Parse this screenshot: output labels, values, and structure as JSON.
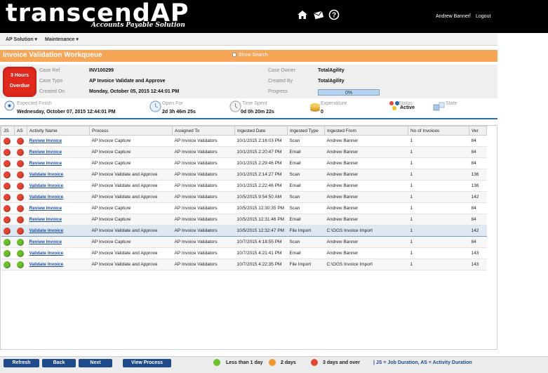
{
  "brand": {
    "name": "transcendAP",
    "tagline": "Accounts Payable Solution"
  },
  "header": {
    "icons": [
      "home-icon",
      "envelope-icon",
      "help-icon"
    ],
    "user": "Andrew Banner",
    "separator": "|",
    "logout": "Logout"
  },
  "menu": {
    "ap_solution": "AP Solution ▾",
    "maintenance": "Maintenance ▾"
  },
  "page": {
    "title": "Invoice Validation Workqueue",
    "show_search": "Show Search"
  },
  "case": {
    "badge_line1": "3 Hours",
    "badge_line2": "Overdue",
    "case_ref_label": "Case Ref",
    "case_ref": "INV100299",
    "case_type_label": "Case Type",
    "case_type": "AP Invoice Validate and Approve",
    "created_on_label": "Created On",
    "created_on": "Monday, October 05, 2015 12:44:01 PM",
    "case_owner_label": "Case Owner",
    "case_owner": "TotalAgility",
    "created_by_label": "Created By",
    "created_by": "TotalAgility",
    "progress_label": "Progress",
    "progress": "0%"
  },
  "stats": {
    "expected_finish_label": "Expected Finish",
    "expected_finish": "Wednesday, October 07, 2015 12:44:01 PM",
    "open_for_label": "Open For",
    "open_for": "2d 3h 46m 25s",
    "time_spent_label": "Time Spent",
    "time_spent": "0d 0h 20m 22s",
    "expenditure_label": "Expenditure",
    "expenditure": "0",
    "status_label": "Status",
    "status": "Active",
    "state_label": "State"
  },
  "table": {
    "columns": [
      "JS",
      "AS",
      "Activity Name",
      "Process",
      "Assigned To",
      "Ingested Date",
      "Ingested Type",
      "Ingested From",
      "No of Invoices",
      "Ver"
    ],
    "rows": [
      {
        "js": "red",
        "as": "red",
        "activity": "Review Invoice",
        "process": "AP Invoice Capture",
        "assigned": "AP Invoice Validators",
        "date": "10/1/2015 2:16:03 PM",
        "type": "Scan",
        "from": "Andrew Banner",
        "count": "1",
        "ver": "84"
      },
      {
        "js": "red",
        "as": "red",
        "activity": "Review Invoice",
        "process": "AP Invoice Capture",
        "assigned": "AP Invoice Validators",
        "date": "10/1/2015 2:20:47 PM",
        "type": "Email",
        "from": "Andrew Banner",
        "count": "1",
        "ver": "84"
      },
      {
        "js": "red",
        "as": "red",
        "activity": "Review Invoice",
        "process": "AP Invoice Capture",
        "assigned": "AP Invoice Validators",
        "date": "10/1/2015 2:29:46 PM",
        "type": "Email",
        "from": "Andrew Banner",
        "count": "1",
        "ver": "84"
      },
      {
        "js": "red",
        "as": "red",
        "activity": "Validate Invoice",
        "process": "AP Invoice Validate and Approve",
        "assigned": "AP Invoice Validators",
        "date": "10/1/2015 2:14:27 PM",
        "type": "Scan",
        "from": "Andrew Banner",
        "count": "1",
        "ver": "136"
      },
      {
        "js": "red",
        "as": "red",
        "activity": "Validate Invoice",
        "process": "AP Invoice Validate and Approve",
        "assigned": "AP Invoice Validators",
        "date": "10/1/2015 2:22:46 PM",
        "type": "Email",
        "from": "Andrew Banner",
        "count": "1",
        "ver": "136"
      },
      {
        "js": "red",
        "as": "red",
        "activity": "Validate Invoice",
        "process": "AP Invoice Validate and Approve",
        "assigned": "AP Invoice Validators",
        "date": "10/5/2015 9:54:50 AM",
        "type": "Scan",
        "from": "Andrew Banner",
        "count": "1",
        "ver": "142"
      },
      {
        "js": "red",
        "as": "red",
        "activity": "Review Invoice",
        "process": "AP Invoice Capture",
        "assigned": "AP Invoice Validators",
        "date": "10/5/2015 12:30:35 PM",
        "type": "Scan",
        "from": "Andrew Banner",
        "count": "1",
        "ver": "84"
      },
      {
        "js": "red",
        "as": "red",
        "activity": "Review Invoice",
        "process": "AP Invoice Capture",
        "assigned": "AP Invoice Validators",
        "date": "10/5/2015 12:31:46 PM",
        "type": "Email",
        "from": "Andrew Banner",
        "count": "1",
        "ver": "84"
      },
      {
        "js": "red",
        "as": "red",
        "activity": "Validate Invoice",
        "process": "AP Invoice Validate and Approve",
        "assigned": "AP Invoice Validators",
        "date": "10/5/2015 12:32:47 PM",
        "type": "File Import",
        "from": "C:\\OGS Invoice Import",
        "count": "1",
        "ver": "142",
        "selected": true
      },
      {
        "js": "green",
        "as": "green",
        "activity": "Review Invoice",
        "process": "AP Invoice Capture",
        "assigned": "AP Invoice Validators",
        "date": "10/7/2015 4:18:55 PM",
        "type": "Scan",
        "from": "Andrew Banner",
        "count": "1",
        "ver": "84"
      },
      {
        "js": "green",
        "as": "green",
        "activity": "Validate Invoice",
        "process": "AP Invoice Validate and Approve",
        "assigned": "AP Invoice Validators",
        "date": "10/7/2015 4:21:41 PM",
        "type": "Email",
        "from": "Andrew Banner",
        "count": "1",
        "ver": "143"
      },
      {
        "js": "green",
        "as": "green",
        "activity": "Validate Invoice",
        "process": "AP Invoice Validate and Approve",
        "assigned": "AP Invoice Validators",
        "date": "10/7/2015 4:22:35 PM",
        "type": "File Import",
        "from": "C:\\OGS Invoice Import",
        "count": "1",
        "ver": "143"
      }
    ]
  },
  "footer": {
    "refresh": "Refresh",
    "back": "Back",
    "next": "Next",
    "view_process": "View Process",
    "legend": [
      {
        "color": "#6cc12c",
        "label": "Less than 1 day"
      },
      {
        "color": "#f0962c",
        "label": "2 days"
      },
      {
        "color": "#e44634",
        "label": "3 days and over"
      }
    ],
    "key": "| JS = Job Duration, AS = Activity Duration"
  },
  "colors": {
    "accent": "#f7a557",
    "nav": "#1e4a8c",
    "overdue": "#e0281c"
  }
}
